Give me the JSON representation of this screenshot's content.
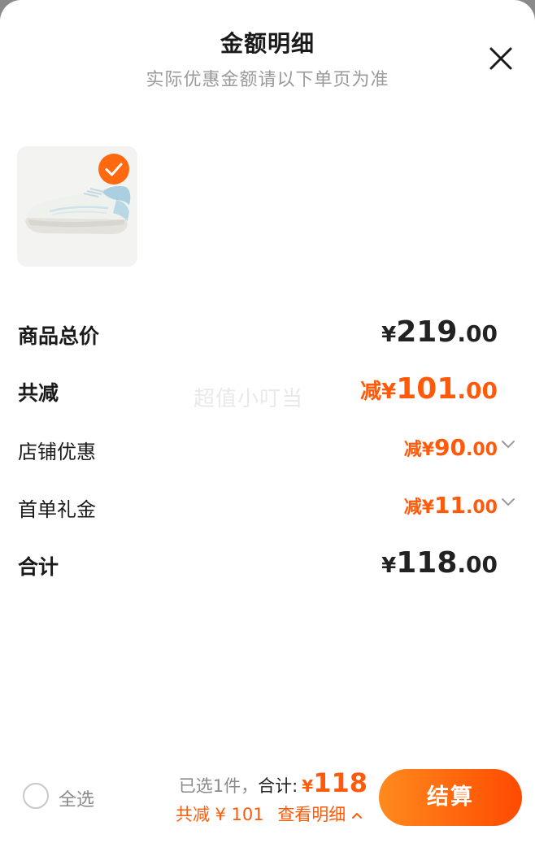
{
  "header": {
    "title": "金额明细",
    "subtitle": "实际优惠金额请以下单页为准"
  },
  "icons": {
    "close": "close-icon",
    "check": "check-icon",
    "chevron": "chevron-down-icon",
    "chevron_up": "chevron-up-icon"
  },
  "product": {
    "selected": true
  },
  "rows": {
    "total_price": {
      "label": "商品总价",
      "prefix": "¥",
      "integer": "219",
      "decimal": ".00"
    },
    "total_discount": {
      "label": "共减",
      "prefix": "减¥",
      "integer": "101",
      "decimal": ".00"
    },
    "store_discount": {
      "label": "店铺优惠",
      "prefix": "减¥",
      "integer": "90",
      "decimal": ".00"
    },
    "first_order_gift": {
      "label": "首单礼金",
      "prefix": "减¥",
      "integer": "11",
      "decimal": ".00"
    },
    "sum": {
      "label": "合计",
      "prefix": "¥",
      "integer": "118",
      "decimal": ".00"
    }
  },
  "watermark": "超值小叮当",
  "bottom_bar": {
    "select_all": "全选",
    "selected_count": "已选1件，",
    "total_label": "合计:",
    "total_prefix": "¥",
    "total_value": "118",
    "discount_text": "共减 ¥ 101",
    "view_detail": "查看明细",
    "checkout": "结算"
  },
  "colors": {
    "accent": "#ff5a0a",
    "checkout_gradient_start": "#ff8a1e",
    "checkout_gradient_end": "#ff4a00",
    "text_primary": "#1a1a1a",
    "text_secondary": "#9a9a9a"
  }
}
